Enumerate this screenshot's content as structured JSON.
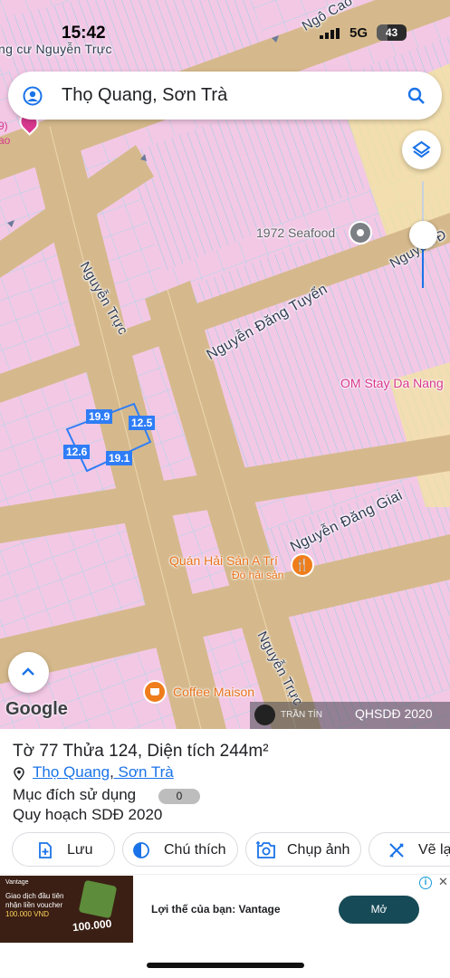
{
  "status_bar": {
    "time": "15:42",
    "network": "5G",
    "battery": "43"
  },
  "search": {
    "query": "Thọ Quang, Sơn Trà"
  },
  "map": {
    "roads": [
      {
        "id": "ngo-cao",
        "label": "Ngô Cao"
      },
      {
        "id": "nguyen-truc-top",
        "label": "ng cư Nguyễn Trực"
      },
      {
        "id": "nguyen-truc-1",
        "label": "Nguyễn Trực"
      },
      {
        "id": "nguyen-dang-tuyen",
        "label": "Nguyễn Đăng Tuyển"
      },
      {
        "id": "nguyen-dang-giai",
        "label": "Nguyễn Đăng Giai"
      },
      {
        "id": "nguyen-truc-2",
        "label": "Nguyễn Trực"
      },
      {
        "id": "nguyen-right",
        "label": "Nguyễn Đ"
      },
      {
        "id": "ngo-right",
        "label": "Ngô"
      }
    ],
    "pois": [
      {
        "name": "1972 Seafood",
        "color": "#5f6368"
      },
      {
        "name": "OM Stay Da Nang",
        "color": "#d8388e"
      },
      {
        "name": "Quán Hải Sản A Trí",
        "sub": "Đồ hải sản",
        "color": "#e8711a"
      },
      {
        "name": "Coffee Maison",
        "color": "#e8711a"
      }
    ],
    "left_edge_texts": [
      "9)",
      "ao"
    ],
    "measurements": [
      "19.9",
      "12.5",
      "12.6",
      "19.1"
    ],
    "google_logo": "Google",
    "watermark_user": "TRẦN TÍN",
    "overlay_label": "QHSDĐ 2020",
    "zoom_level": 0.5
  },
  "parcel": {
    "title": "Tờ 77 Thửa 124, Diện tích 244m²",
    "ward": "Thọ Quang",
    "district": "Sơn Trà",
    "purpose_label": "Mục đích sử dụng",
    "purpose_value": "0",
    "plan_label": "Quy hoạch SDĐ 2020"
  },
  "actions": [
    {
      "label": "Lưu",
      "icon": "save-add-icon"
    },
    {
      "label": "Chú thích",
      "icon": "legend-icon"
    },
    {
      "label": "Chụp ảnh",
      "icon": "camera-add-icon"
    },
    {
      "label": "Vẽ lạ",
      "icon": "draw-icon"
    }
  ],
  "ad": {
    "headline": "Lợi thế của bạn: Vantage",
    "cta": "Mở",
    "brand": "Vantage",
    "img_line1": "Giao dịch đầu tiên",
    "img_line2": "nhận liền voucher",
    "img_line3": "100.000 VND",
    "img_amount": "100.000"
  },
  "colors": {
    "accent": "#1a73e8",
    "land_pink": "#f3c9e6",
    "road": "#d3b98f",
    "measure_blue": "#2f7df6"
  }
}
